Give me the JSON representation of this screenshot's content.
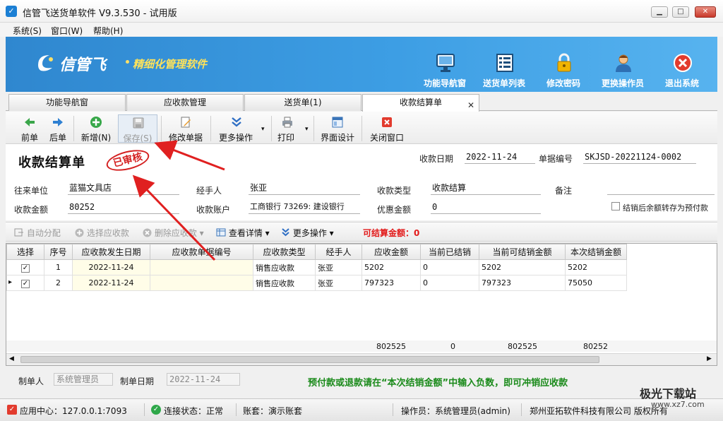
{
  "window": {
    "title": "信管飞送货单软件 V9.3.530 - 试用版",
    "minimize_glyph": "▁",
    "maximize_glyph": "□",
    "close_glyph": "✕"
  },
  "menu": [
    "系统(S)",
    "窗口(W)",
    "帮助(H)"
  ],
  "banner": {
    "logo_text": "信管飞",
    "slogan": "精细化管理软件",
    "buttons": [
      {
        "label": "功能导航窗",
        "icon": "monitor-icon"
      },
      {
        "label": "送货单列表",
        "icon": "list-icon"
      },
      {
        "label": "修改密码",
        "icon": "lock-icon"
      },
      {
        "label": "更换操作员",
        "icon": "user-icon"
      },
      {
        "label": "退出系统",
        "icon": "exit-icon"
      }
    ]
  },
  "tabs": [
    "功能导航窗",
    "应收款管理",
    "送货单(1)",
    "收款结算单"
  ],
  "tab_close": "✕",
  "toolbar": {
    "prev": "前单",
    "next": "后单",
    "add": "新增(N)",
    "save": "保存(S)",
    "edit": "修改单据",
    "more": "更多操作",
    "print": "打印",
    "design": "界面设计",
    "close": "关闭窗口"
  },
  "form": {
    "title": "收款结算单",
    "stamp": "已审核",
    "date_label": "收款日期",
    "date_value": "2022-11-24",
    "doc_no_label": "单据编号",
    "doc_no_value": "SKJSD-20221124-0002",
    "partner_label": "往来单位",
    "partner_value": "蓝猫文具店",
    "handler_label": "经手人",
    "handler_value": "张亚",
    "type_label": "收款类型",
    "type_value": "收款结算",
    "remark_label": "备注",
    "remark_value": "",
    "amount_label": "收款金额",
    "amount_value": "80252",
    "account_label": "收款账户",
    "account_value": "工商银行 73269: 建设银行",
    "discount_label": "优惠金额",
    "discount_value": "0",
    "transfer_label": "结销后余额转存为预付款"
  },
  "subtoolbar": {
    "auto": "自动分配",
    "select": "选择应收款",
    "delete": "删除应收款",
    "details": "查看详情",
    "more": "更多操作",
    "settle_label": "可结算金额：0"
  },
  "grid": {
    "columns": [
      "选择",
      "序号",
      "应收款发生日期",
      "应收款单据编号",
      "应收款类型",
      "经手人",
      "应收金额",
      "当前已结销",
      "当前可结销金额",
      "本次结销金额"
    ],
    "rows": [
      {
        "selected": "✓",
        "no": "1",
        "date": "2022-11-24",
        "doc": "",
        "type": "销售应收款",
        "handler": "张亚",
        "amount": "5202",
        "settled": "0",
        "available": "5202",
        "this_time": "5202"
      },
      {
        "selected": "✓",
        "no": "2",
        "date": "2022-11-24",
        "doc": "",
        "type": "销售应收款",
        "handler": "张亚",
        "amount": "797323",
        "settled": "0",
        "available": "797323",
        "this_time": "75050"
      }
    ],
    "row_pointer": "▸",
    "totals": {
      "amount": "802525",
      "settled": "0",
      "available": "802525",
      "this_time": "80252"
    }
  },
  "footer": {
    "maker_label": "制单人",
    "maker_value": "系统管理员",
    "make_date_label": "制单日期",
    "make_date_value": "2022-11-24",
    "note": "预付款或退款请在“本次结销金额”中输入负数，即可冲销应收款"
  },
  "status": {
    "app_center": "应用中心：127.0.0.1:7093",
    "connection": "连接状态：正常",
    "account_set": "账套：演示账套",
    "operator": "操作员：系统管理员(admin)",
    "company": "郑州亚拓软件科技有限公司 版权所有"
  },
  "watermark": {
    "text": "极光下载站",
    "url": "www.xz7.com"
  },
  "colors": {
    "banner": "#3d9ee4",
    "accent_red": "#e21a1a",
    "note_green": "#1a8a1a",
    "slogan_yellow": "#ffe35a"
  }
}
